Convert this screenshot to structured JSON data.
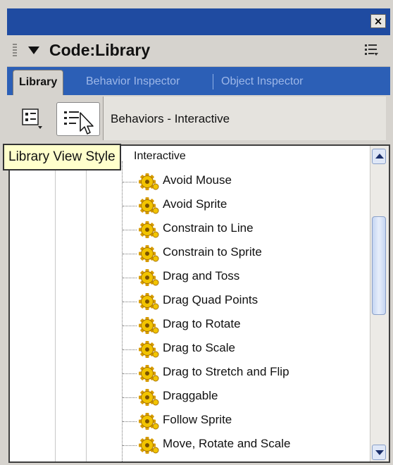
{
  "window": {
    "close_glyph": "×"
  },
  "panel": {
    "title": "Code:Library"
  },
  "tabs": [
    {
      "label": "Library",
      "active": true
    },
    {
      "label": "Behavior Inspector",
      "active": false
    },
    {
      "label": "Object Inspector",
      "active": false
    }
  ],
  "toolbar": {
    "category": "Behaviors - Interactive"
  },
  "tooltip": {
    "text": "Library View Style"
  },
  "tree": {
    "group_label": "Interactive",
    "items": [
      "Avoid Mouse",
      "Avoid Sprite",
      "Constrain to Line",
      "Constrain to Sprite",
      "Drag and Toss",
      "Drag Quad Points",
      "Drag to Rotate",
      "Drag to Scale",
      "Drag to Stretch and Flip",
      "Draggable",
      "Follow Sprite",
      "Move, Rotate and Scale"
    ]
  },
  "colors": {
    "title_bar": "#1f4ba1",
    "tab_bar": "#2c5fb6",
    "panel_bg": "#d6d3ce",
    "tooltip_bg": "#ffffcc",
    "gear_yellow": "#f2c400"
  },
  "icons": [
    "close-icon",
    "collapse-triangle-icon",
    "panel-options-icon",
    "library-list-view-icon",
    "library-view-style-icon",
    "gear-behavior-icon",
    "scroll-up-icon",
    "scroll-down-icon"
  ]
}
